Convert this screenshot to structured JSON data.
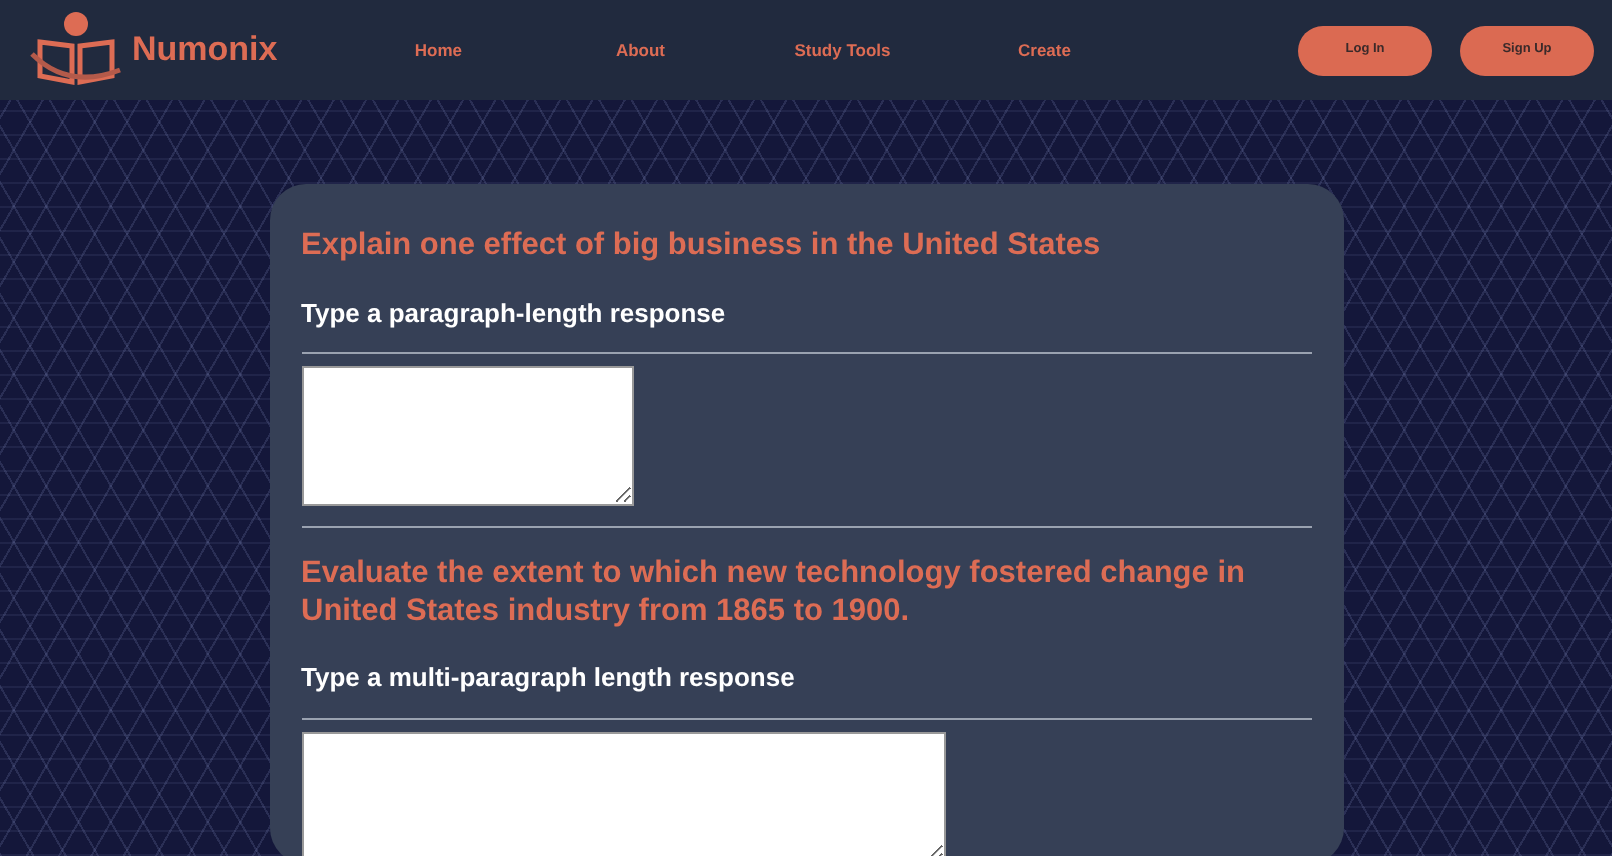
{
  "brand": {
    "name": "Numonix"
  },
  "nav": [
    {
      "label": "Home"
    },
    {
      "label": "About"
    },
    {
      "label": "Study Tools"
    },
    {
      "label": "Create"
    }
  ],
  "buttons": [
    {
      "label": "Log In"
    },
    {
      "label": "Sign Up"
    }
  ],
  "questions": [
    {
      "prompt": "Explain one effect of big business in the United States",
      "instruction": "Type a paragraph-length response",
      "kind": "short"
    },
    {
      "prompt": "Evaluate the extent to which new technology fostered change in United States industry from 1865 to 1900.",
      "instruction": "Type a multi-paragraph length response",
      "kind": "long"
    }
  ]
}
